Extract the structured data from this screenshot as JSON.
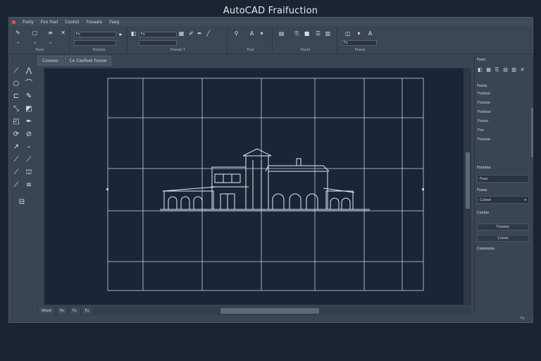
{
  "window": {
    "title": "AutoCAD Fraifuction"
  },
  "menubar": {
    "items": [
      "Fooly",
      "Foo Fael",
      "Cooliol",
      "Fosaale",
      "Faag"
    ]
  },
  "ribbon": {
    "groups": [
      {
        "label": "Fooo"
      },
      {
        "label": "Fooobo"
      },
      {
        "label": "Fooole T"
      },
      {
        "label": "Fool"
      },
      {
        "label": "Foool"
      },
      {
        "label": "Foooo"
      }
    ],
    "fields": [
      "Fo",
      "Fo",
      "Fo"
    ]
  },
  "tabs": [
    "Cooooo",
    "Co Coofoot Foooo"
  ],
  "statusbar": {
    "items": [
      "Wooe",
      "Po",
      "Fo",
      "Fo"
    ]
  },
  "panel": {
    "header": "Fooo",
    "section1_title": "Fooos",
    "layers": [
      "Foolost",
      "Fooooo",
      "Fooloso",
      "Foooo",
      "Foo",
      "Fooooe"
    ],
    "section2_title": "Foooloo",
    "field_label": "Foos",
    "section3_title": "Fooso",
    "dropdown_value": "Coloot",
    "section4_title": "Cooloo",
    "button1": "Fooooo",
    "button2": "Cooos",
    "footer": "Cooooooo"
  },
  "corner_label": "Fo",
  "icons": [
    "line-icon",
    "polyline-icon",
    "circle-icon",
    "arc-icon",
    "rectangle-icon",
    "hatch-icon",
    "move-icon",
    "copy-icon",
    "trim-icon",
    "extend-icon",
    "text-icon",
    "dimension-icon",
    "layer-icon",
    "zoom-icon"
  ]
}
